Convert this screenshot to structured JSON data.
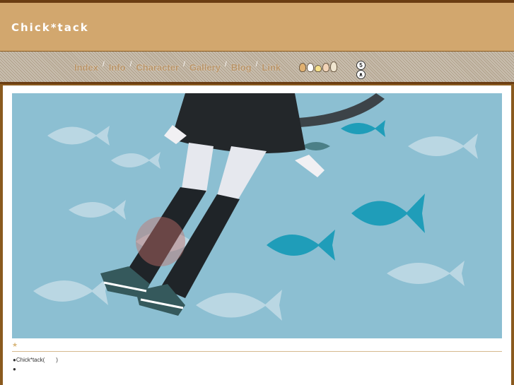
{
  "header": {
    "title": "Chick*tack"
  },
  "nav": {
    "items": [
      {
        "label": "Index"
      },
      {
        "label": "Info"
      },
      {
        "label": "Character"
      },
      {
        "label": "Gallery"
      },
      {
        "label": "Blog"
      },
      {
        "label": "Link"
      }
    ],
    "separator": "/",
    "badge_numbers": [
      "5"
    ]
  },
  "content": {
    "star": "★",
    "lines": [
      {
        "bullet": "●",
        "text": "Chick*tack(　　)"
      },
      {
        "bullet": "●",
        "text": ""
      }
    ]
  },
  "colors": {
    "header_bg": "#d2a76e",
    "frame": "#8a5a1e",
    "nav_text": "#b89366",
    "illustration_bg": "#8cbfd2"
  }
}
